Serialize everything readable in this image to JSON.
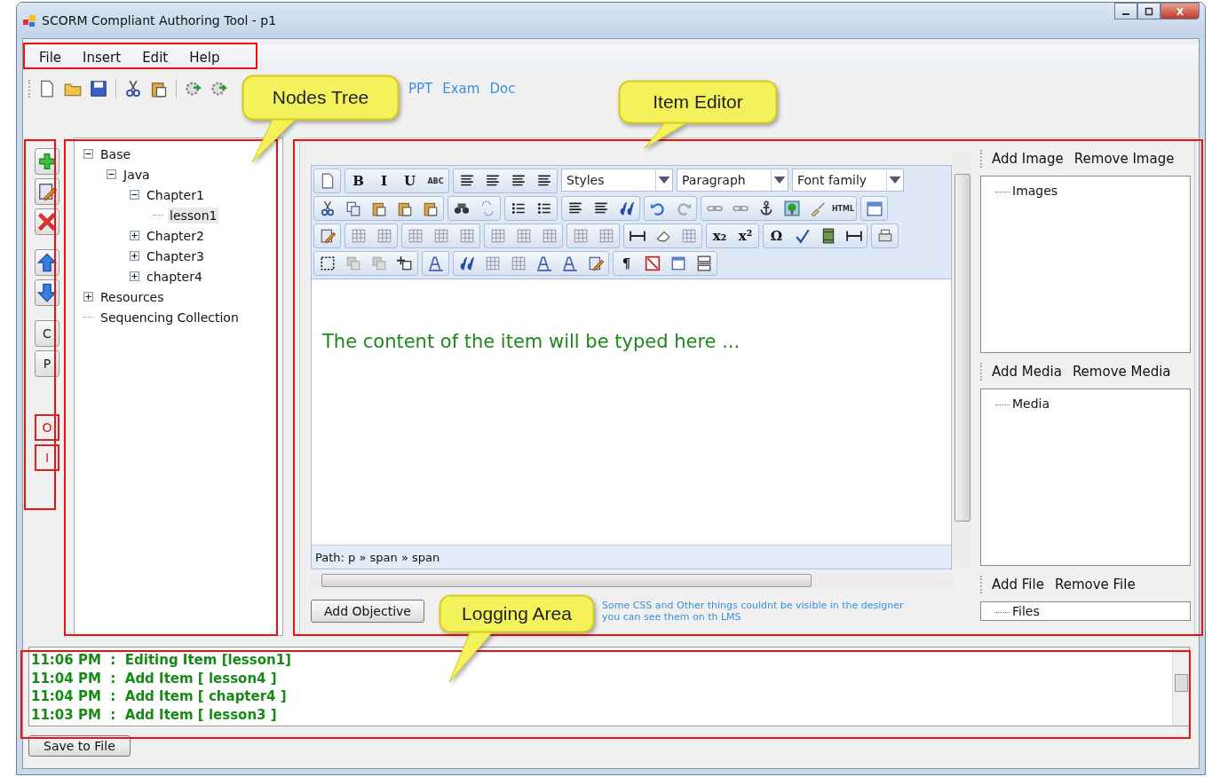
{
  "window": {
    "title": "SCORM Compliant Authoring Tool - p1"
  },
  "menu": [
    "File",
    "Insert",
    "Edit",
    "Help"
  ],
  "toolbar": {
    "links": [
      "PPT",
      "Exam",
      "Doc"
    ]
  },
  "side_buttons": [
    {
      "label": "C",
      "kind": "plain"
    },
    {
      "label": "P",
      "kind": "plain"
    },
    {
      "label": "O",
      "kind": "marked"
    },
    {
      "label": "I",
      "kind": "marked"
    }
  ],
  "tree": [
    {
      "label": "Base",
      "expanded": true,
      "selected": false,
      "children": [
        {
          "label": "Java",
          "expanded": true,
          "selected": false,
          "children": [
            {
              "label": "Chapter1",
              "expanded": true,
              "selected": false,
              "children": [
                {
                  "label": "lesson1",
                  "selected": true
                }
              ]
            },
            {
              "label": "Chapter2",
              "expanded": false,
              "selected": false
            },
            {
              "label": "Chapter3",
              "expanded": false,
              "selected": false
            },
            {
              "label": "chapter4",
              "expanded": false,
              "selected": false
            }
          ]
        }
      ]
    },
    {
      "label": "Resources",
      "expanded": false,
      "selected": false
    },
    {
      "label": "Sequencing Collection",
      "selected": false
    }
  ],
  "editor": {
    "glyph_buttons": [
      "B",
      "I",
      "U",
      "ABC",
      "HTML",
      "x₂",
      "x²",
      "Ω",
      "¶"
    ],
    "dropdowns": [
      "Styles",
      "Paragraph",
      "Font family"
    ],
    "content": "The content of the item will be typed here ...",
    "path": "Path: p » span » span"
  },
  "objective_button": "Add Objective",
  "note": [
    "Some CSS and Other things couldnt be visible in the designer",
    "you can see them on th LMS"
  ],
  "resources": [
    {
      "buttons": [
        "Add Image",
        "Remove Image"
      ],
      "root": "Images"
    },
    {
      "buttons": [
        "Add Media",
        "Remove Media"
      ],
      "root": "Media"
    },
    {
      "buttons": [
        "Add File",
        "Remove File"
      ],
      "root": "Files"
    }
  ],
  "log": [
    "11:06 PM  :  Editing Item [lesson1]",
    "11:04 PM  :  Add Item [ lesson4 ]",
    "11:04 PM  :  Add Item [ chapter4 ]",
    "11:03 PM  :  Add Item [ lesson3 ]"
  ],
  "save_button": "Save to File",
  "callouts": [
    "Nodes Tree",
    "Item Editor",
    "Logging Area"
  ]
}
